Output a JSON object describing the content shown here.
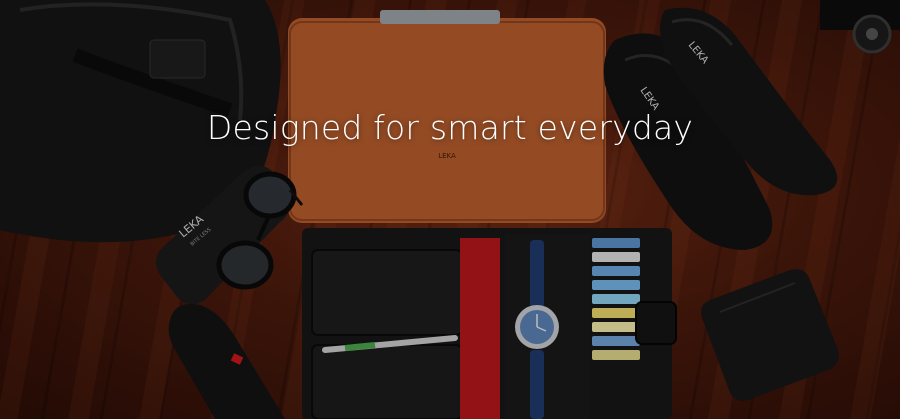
{
  "hero": {
    "headline": "Designed for smart everyday"
  },
  "brand_marks": {
    "laptop_sleeve_logo": "LEKA",
    "shoe_left_logo": "LEKA",
    "shoe_right_logo": "LEKA",
    "glasses_case_logo": "LEKA",
    "glasses_case_subtext": "BITE LESS"
  },
  "colors": {
    "floor": "#4a1a0c",
    "leather_black": "#141414",
    "sleeve_tan": "#b55c2d",
    "accent_red": "#b3161b",
    "headline_text": "#ffffff"
  }
}
